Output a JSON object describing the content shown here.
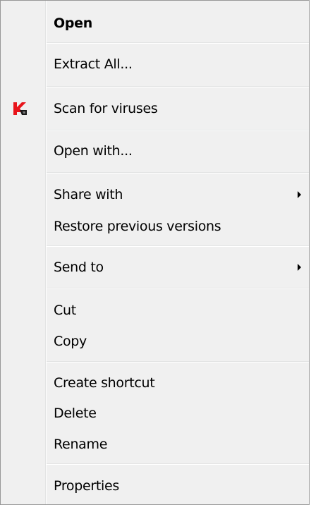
{
  "context_menu": {
    "items": [
      {
        "label": "Open"
      },
      {
        "label": "Extract All..."
      },
      {
        "label": "Scan for viruses",
        "icon": "kaspersky-icon"
      },
      {
        "label": "Open with..."
      },
      {
        "label": "Share with",
        "submenu": true
      },
      {
        "label": "Restore previous versions"
      },
      {
        "label": "Send to",
        "submenu": true
      },
      {
        "label": "Cut"
      },
      {
        "label": "Copy"
      },
      {
        "label": "Create shortcut"
      },
      {
        "label": "Delete"
      },
      {
        "label": "Rename"
      },
      {
        "label": "Properties"
      }
    ]
  },
  "colors": {
    "menu_background": "#f0f0f0",
    "border": "#979797",
    "separator": "#e2e3e3",
    "icon_red": "#e8141b"
  }
}
